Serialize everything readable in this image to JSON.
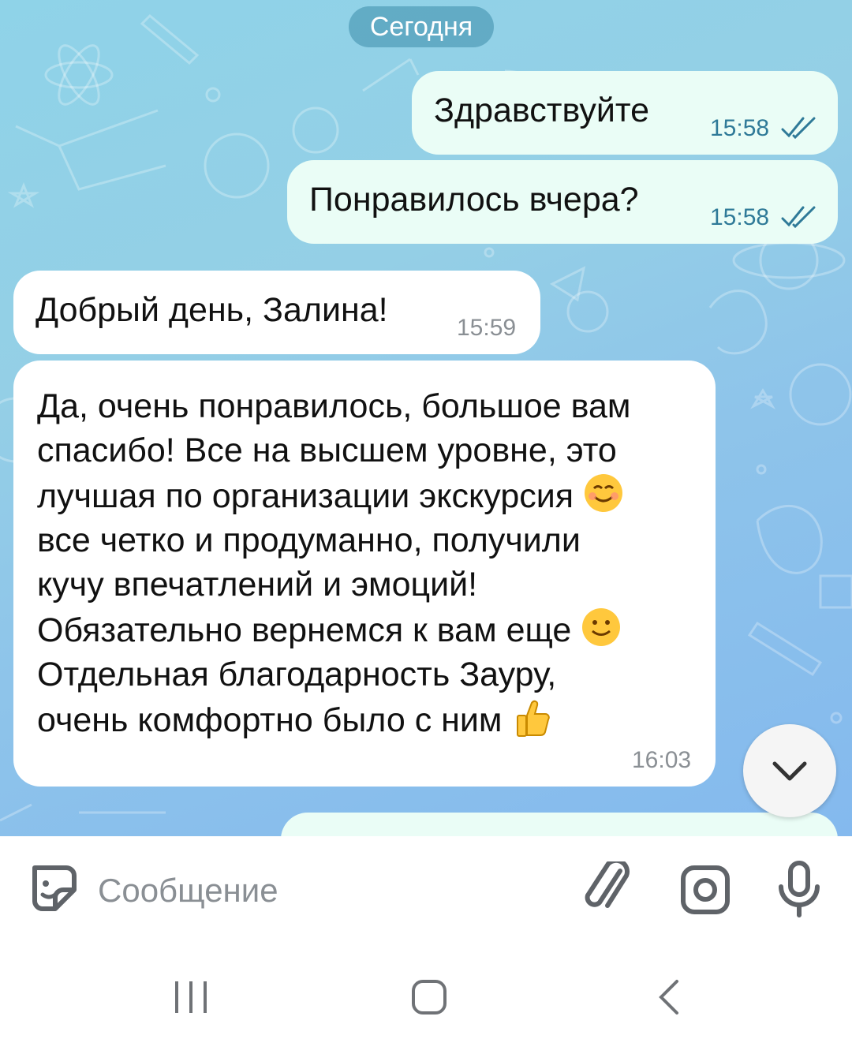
{
  "chat": {
    "date_label": "Сегодня",
    "messages": [
      {
        "direction": "out",
        "text": "Здравствуйте",
        "time": "15:58",
        "status": "read"
      },
      {
        "direction": "out",
        "text": "Понравилось вчера?",
        "time": "15:58",
        "status": "read"
      },
      {
        "direction": "in",
        "text": "Добрый день, Залина!",
        "time": "15:59"
      },
      {
        "direction": "in",
        "lines": [
          "Да, очень понравилось, большое вам",
          "спасибо! Все на высшем уровне, это",
          "лучшая по организации экскурсия",
          "все четко и продуманно, получили",
          "кучу впечатлений и эмоций!",
          "Обязательно вернемся к вам еще",
          "Отдельная благодарность Зауру,",
          "очень комфортно было с ним"
        ],
        "emojis": [
          "smiling-face-emoji",
          "slightly-smiling-face-emoji",
          "thumbs-up-emoji"
        ],
        "time": "16:03"
      }
    ]
  },
  "composer": {
    "placeholder": "Сообщение"
  },
  "icons": [
    "sticker-icon",
    "attach-icon",
    "camera-icon",
    "microphone-icon",
    "chevron-down-icon",
    "recent-apps-icon",
    "home-icon",
    "back-icon"
  ],
  "colors": {
    "outgoing_bubble": "#eafdf6",
    "incoming_bubble": "#ffffff",
    "check_marks": "#2f7a98"
  }
}
